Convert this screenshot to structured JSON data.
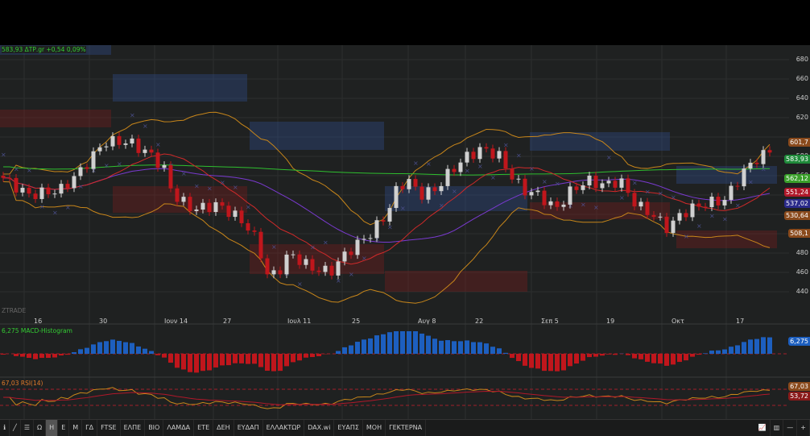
{
  "header": {
    "symbol_quote": "583,93 ΔΤΡ.gr +0,54 0,09%"
  },
  "watermark": "ZTRADE",
  "y_axis": [
    "680",
    "660",
    "640",
    "620",
    "580",
    "560",
    "540",
    "520",
    "480",
    "460",
    "440"
  ],
  "x_axis": [
    "16",
    "30",
    "Ιουν 14",
    "27",
    "Ιουλ 11",
    "25",
    "Αυγ 8",
    "22",
    "Σεπ 5",
    "19",
    "Οκτ",
    "17"
  ],
  "price_tags": [
    {
      "text": "601,7",
      "color": "#8a4a1c"
    },
    {
      "text": "583,93",
      "color": "#1f8a3a"
    },
    {
      "text": "562,12",
      "color": "#3aa02a"
    },
    {
      "text": "551,24",
      "color": "#b0182a"
    },
    {
      "text": "537,02",
      "color": "#2a2a8a"
    },
    {
      "text": "530,64",
      "color": "#8a4a1c"
    },
    {
      "text": "508,1",
      "color": "#8a4a1c"
    }
  ],
  "macd": {
    "label": "6,275 MACD-Histogram",
    "tag": "6,275"
  },
  "rsi": {
    "label": "67,03 RSI(14)",
    "tag": "67,03",
    "tag2": "53,72"
  },
  "toolbar": {
    "buttons": [
      "Ω",
      "Η",
      "Ε",
      "Μ",
      "ΓΔ",
      "FTSE",
      "ΕΛΠΕ",
      "ΒΙΟ",
      "ΛΑΜΔΑ",
      "ΕΤΕ",
      "ΔΕΗ",
      "ΕΥΔΑΠ",
      "ΕΛΛΑΚΤΩΡ",
      "DAX.wi",
      "ΕΥΑΠΣ",
      "ΜΟΗ",
      "ΓΕΚΤΕΡΝΑ"
    ],
    "active": "Η"
  },
  "chart_data": {
    "type": "candlestick",
    "title": "ΔΤΡ.gr",
    "ylim": [
      430,
      690
    ],
    "close_path": [
      [
        0,
        560
      ],
      [
        35,
        540
      ],
      [
        75,
        545
      ],
      [
        100,
        565
      ],
      [
        115,
        580
      ],
      [
        130,
        595
      ],
      [
        160,
        595
      ],
      [
        190,
        580
      ],
      [
        205,
        565
      ],
      [
        215,
        540
      ],
      [
        240,
        525
      ],
      [
        270,
        530
      ],
      [
        290,
        520
      ],
      [
        310,
        505
      ],
      [
        320,
        490
      ],
      [
        333,
        455
      ],
      [
        345,
        460
      ],
      [
        360,
        480
      ],
      [
        385,
        465
      ],
      [
        410,
        460
      ],
      [
        430,
        480
      ],
      [
        460,
        500
      ],
      [
        480,
        520
      ],
      [
        495,
        550
      ],
      [
        510,
        555
      ],
      [
        520,
        540
      ],
      [
        540,
        545
      ],
      [
        560,
        565
      ],
      [
        580,
        580
      ],
      [
        600,
        588
      ],
      [
        620,
        580
      ],
      [
        635,
        560
      ],
      [
        650,
        545
      ],
      [
        670,
        540
      ],
      [
        690,
        525
      ],
      [
        710,
        545
      ],
      [
        730,
        555
      ],
      [
        750,
        550
      ],
      [
        770,
        555
      ],
      [
        790,
        530
      ],
      [
        810,
        520
      ],
      [
        830,
        505
      ],
      [
        845,
        520
      ],
      [
        870,
        530
      ],
      [
        900,
        535
      ],
      [
        920,
        560
      ],
      [
        935,
        575
      ],
      [
        955,
        584
      ]
    ],
    "last": 583.93,
    "change": 0.54,
    "change_pct": 0.09
  }
}
